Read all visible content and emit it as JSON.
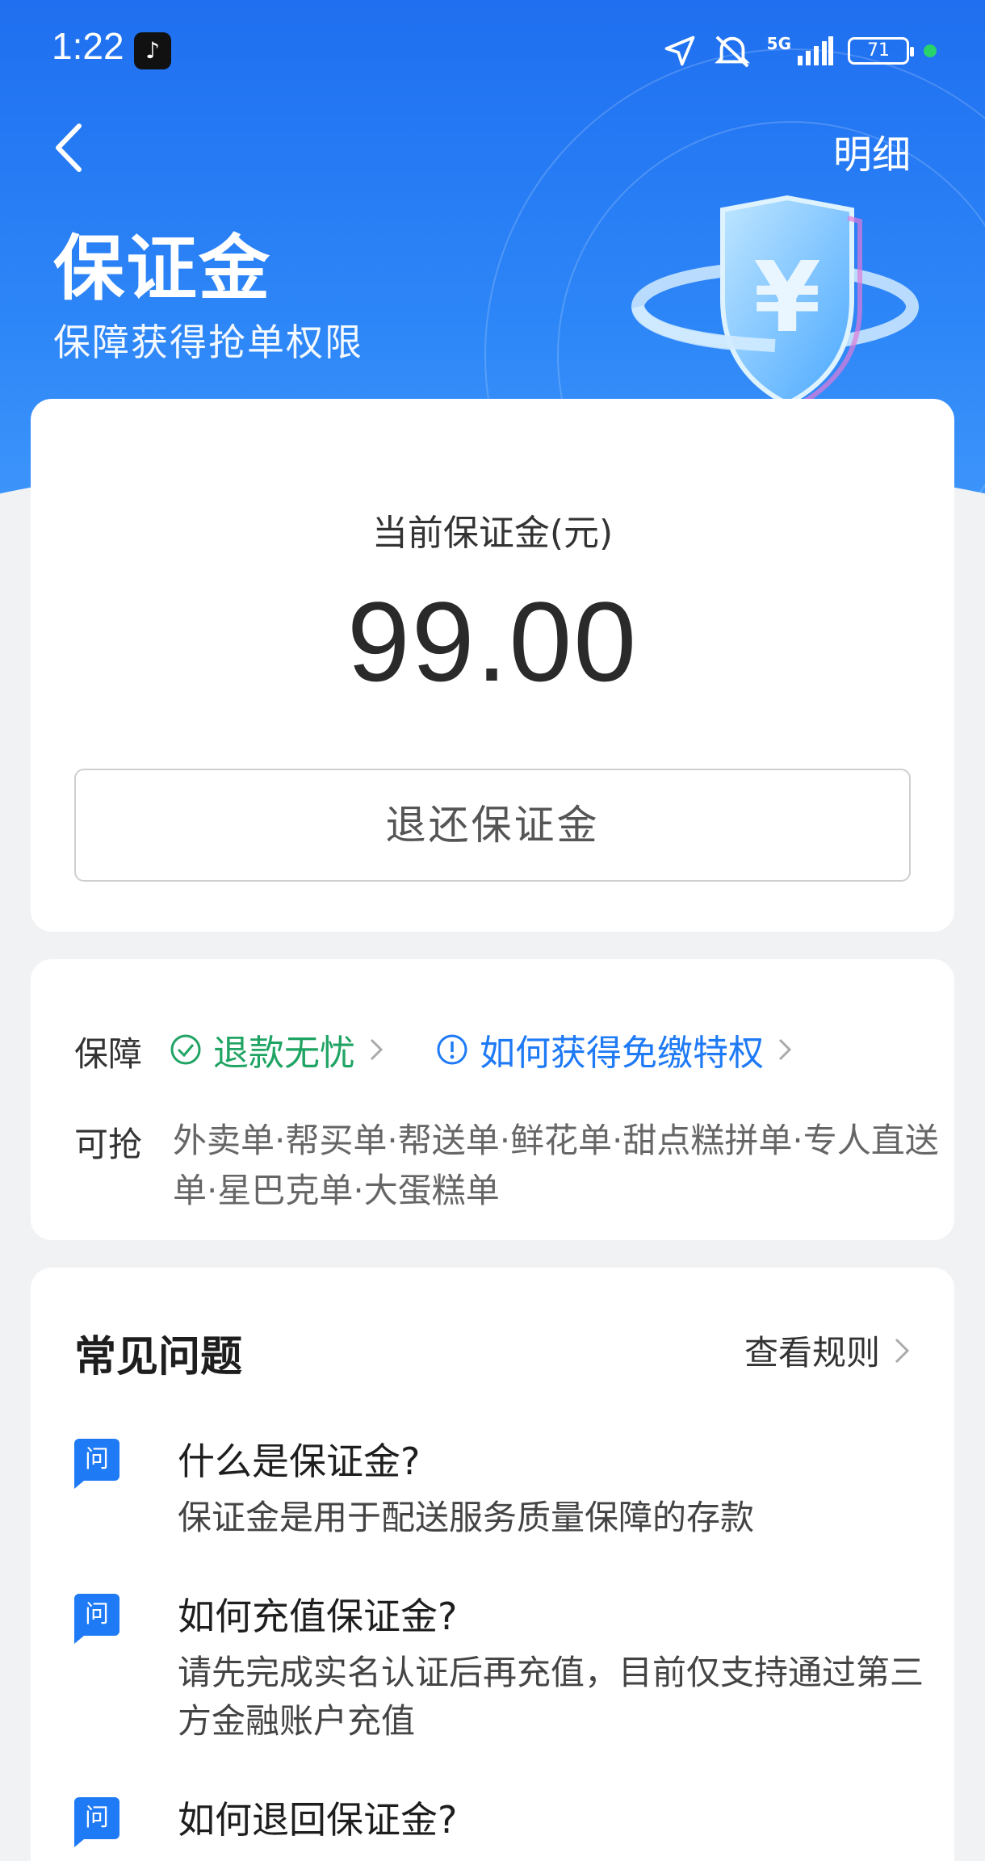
{
  "status_bar": {
    "time": "1:22",
    "network": "5G",
    "battery": "71"
  },
  "header": {
    "detail_link": "明细",
    "title": "保证金",
    "subtitle": "保障获得抢单权限"
  },
  "balance": {
    "label": "当前保证金(元)",
    "value": "99.00",
    "refund_button": "退还保证金"
  },
  "guarantee": {
    "label": "保障",
    "refund_worry_free": "退款无忧",
    "free_privilege": "如何获得免缴特权",
    "grab_label": "可抢",
    "grab_tags": "外卖单·帮买单·帮送单·鲜花单·甜点糕拼单·专人直送单·星巴克单·大蛋糕单"
  },
  "faq": {
    "title": "常见问题",
    "rules_link": "查看规则",
    "badge": "问",
    "items": [
      {
        "q": "什么是保证金?",
        "a": "保证金是用于配送服务质量保障的存款"
      },
      {
        "q": "如何充值保证金?",
        "a": "请先完成实名认证后再充值，目前仅支持通过第三方金融账户充值"
      },
      {
        "q": "如何退回保证金?",
        "a": ""
      }
    ]
  },
  "colors": {
    "primary_blue": "#1f6ff0",
    "success_green": "#1fa463",
    "link_blue": "#1f7af5"
  }
}
